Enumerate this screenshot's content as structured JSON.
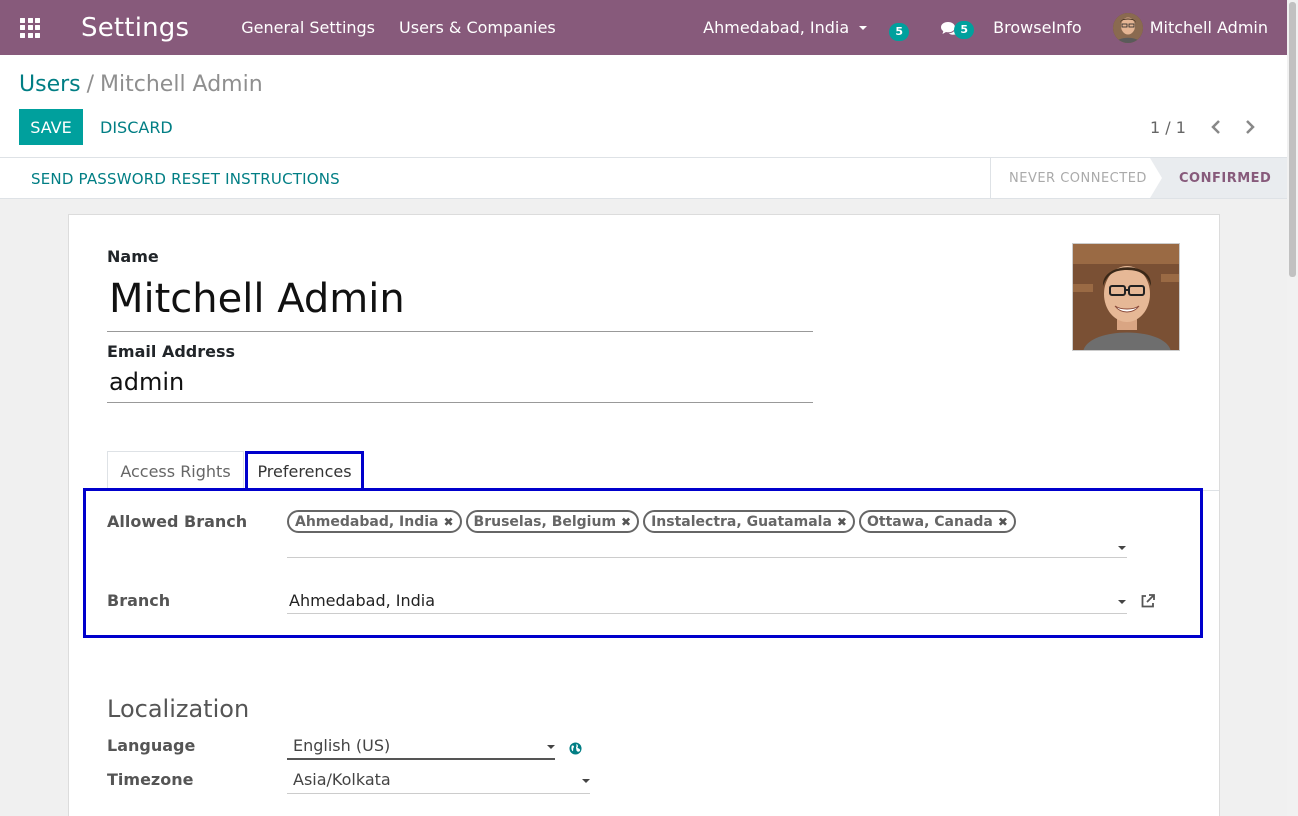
{
  "navbar": {
    "app_title": "Settings",
    "menu": [
      "General Settings",
      "Users & Companies"
    ],
    "branch": "Ahmedabad, India",
    "activity_count": "5",
    "messages_count": "5",
    "company": "BrowseInfo",
    "user": "Mitchell Admin",
    "icons": {
      "apps": "apps-grid-icon",
      "messages": "chat-bubbles-icon"
    },
    "colors": {
      "bar": "#875a7b",
      "badge": "#00a09d"
    }
  },
  "control_panel": {
    "breadcrumb_parent": "Users",
    "breadcrumb_sep": "/",
    "breadcrumb_current": "Mitchell Admin",
    "save_label": "SAVE",
    "discard_label": "DISCARD",
    "pager": "1 / 1"
  },
  "statusbar": {
    "action": "SEND PASSWORD RESET INSTRUCTIONS",
    "stages": [
      "NEVER CONNECTED",
      "CONFIRMED"
    ],
    "active_stage": "CONFIRMED"
  },
  "form": {
    "name_label": "Name",
    "name_value": "Mitchell Admin",
    "email_label": "Email Address",
    "email_value": "admin",
    "tabs": [
      "Access Rights",
      "Preferences"
    ],
    "active_tab": "Preferences",
    "allowed_branch_label": "Allowed Branch",
    "allowed_branches": [
      "Ahmedabad, India",
      "Bruselas, Belgium",
      "Instalectra, Guatamala",
      "Ottawa, Canada"
    ],
    "branch_label": "Branch",
    "branch_value": "Ahmedabad, India",
    "localization_title": "Localization",
    "language_label": "Language",
    "language_value": "English (US)",
    "timezone_label": "Timezone",
    "timezone_value": "Asia/Kolkata",
    "colors": {
      "accent": "#00a09d",
      "link": "#017e84",
      "highlight": "#0000cc"
    }
  }
}
